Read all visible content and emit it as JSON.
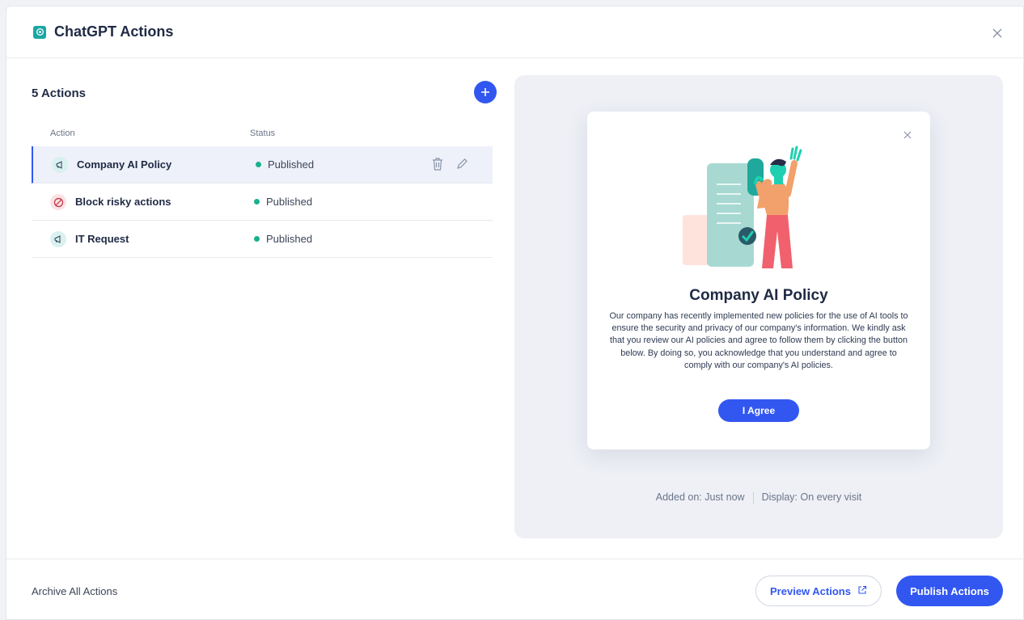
{
  "header": {
    "title": "ChatGPT Actions",
    "logo_icon": "chatgpt-logo-icon",
    "close_icon": "close-icon"
  },
  "actions_list": {
    "count_label": "5 Actions",
    "add_icon": "plus-icon",
    "columns": [
      "Action",
      "Status"
    ],
    "rows": [
      {
        "name": "Company AI Policy",
        "status": "Published",
        "icon": "megaphone-icon",
        "selected": true
      },
      {
        "name": "Block risky actions",
        "status": "Published",
        "icon": "block-icon",
        "selected": false
      },
      {
        "name": "IT Request",
        "status": "Published",
        "icon": "megaphone-icon",
        "selected": false
      }
    ]
  },
  "preview": {
    "title": "Company AI Policy",
    "body": "Our company has recently implemented new policies for the use of AI tools to ensure the security and privacy of our company's information. We kindly ask that you review our AI policies and agree to follow them by clicking the button below. By doing so, you acknowledge that you understand and agree to comply with our company's AI policies.",
    "button": "I Agree",
    "added_on": "Added on: Just now",
    "display": "Display: On every visit"
  },
  "footer": {
    "archive_label": "Archive All Actions",
    "preview_label": "Preview Actions",
    "publish_label": "Publish Actions"
  },
  "colors": {
    "accent": "#3257f1",
    "published": "#1ab08f"
  }
}
